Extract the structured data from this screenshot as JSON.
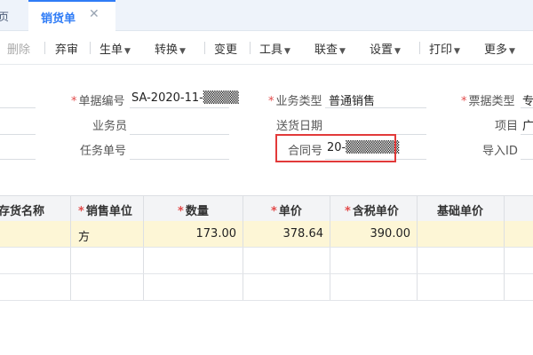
{
  "tabs": {
    "prev_label": "页",
    "active_label": "销货单",
    "close_glyph": "✕"
  },
  "toolbar": {
    "delete": "删除",
    "abandon": "弃审",
    "generate": "生单",
    "convert": "转换",
    "change": "变更",
    "tools": "工具",
    "linked_query": "联查",
    "settings": "设置",
    "print": "打印",
    "more": "更多",
    "caret": "⌵"
  },
  "form": {
    "doc_no_label": "单据编号",
    "doc_no_value": "SA-2020-11-▒▒▒▒",
    "biz_type_label": "业务类型",
    "biz_type_value": "普通销售",
    "bill_type_label": "票据类型",
    "bill_type_value": "专",
    "salesperson_label": "业务员",
    "delivery_date_label": "送货日期",
    "project_label": "项目",
    "project_value": "广",
    "task_no_label": "任务单号",
    "contract_no_label": "合同号",
    "contract_no_value": "20-▒▒▒▒▒▒",
    "import_id_label": "导入ID"
  },
  "grid": {
    "headers": {
      "goods_name": "存货名称",
      "unit": "销售单位",
      "qty": "数量",
      "price": "单价",
      "tax_price": "含税单价",
      "base_price": "基础单价"
    },
    "row1": {
      "unit": "方",
      "qty": "173.00",
      "price": "378.64",
      "tax_price": "390.00"
    }
  },
  "colors": {
    "accent": "#2f7cf6",
    "required": "#e24b4b",
    "highlight_box": "#e23a3a",
    "selected_row": "#fdf6d6"
  }
}
